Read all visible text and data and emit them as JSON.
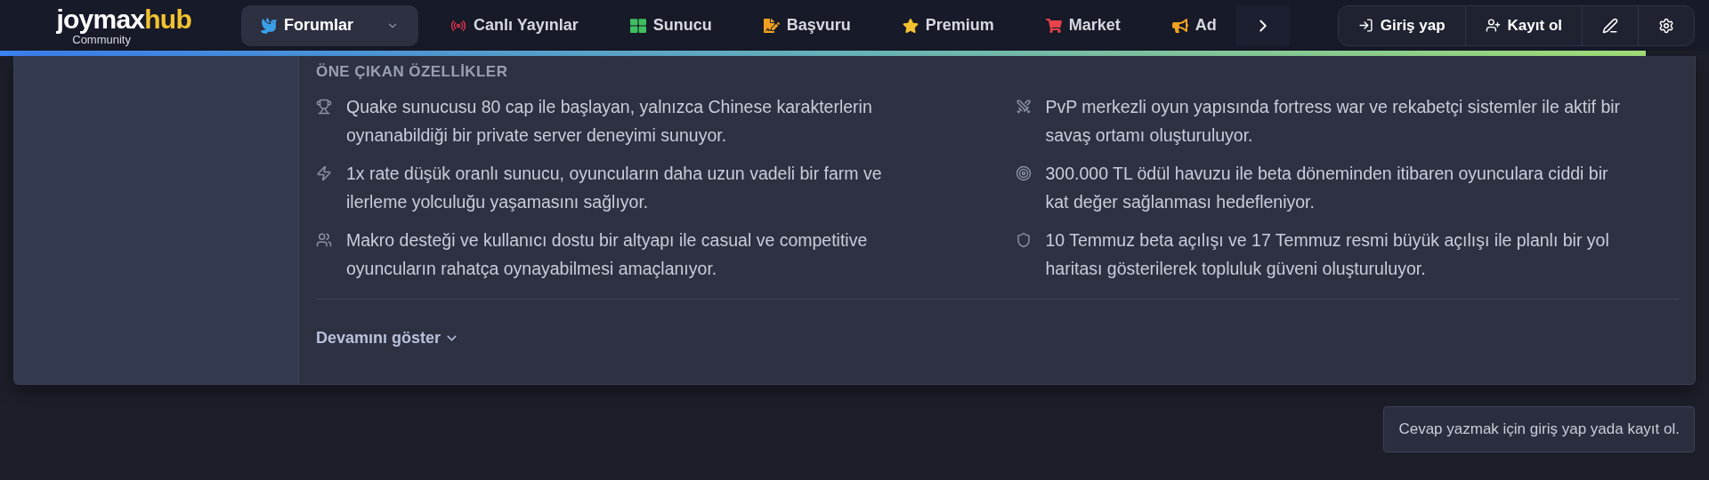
{
  "logo": {
    "main": "joymax",
    "accent": "hub",
    "sub": "Community"
  },
  "nav": [
    {
      "label": "Forumlar",
      "selected": true,
      "color": "#3b9fe8",
      "dropdown": true
    },
    {
      "label": "Canlı Yayınlar",
      "selected": false,
      "color": "#e0344d"
    },
    {
      "label": "Sunucu",
      "selected": false,
      "color": "#3fbf5f"
    },
    {
      "label": "Başvuru",
      "selected": false,
      "color": "#f0a020"
    },
    {
      "label": "Premium",
      "selected": false,
      "color": "#f2c230"
    },
    {
      "label": "Market",
      "selected": false,
      "color": "#e8424a"
    },
    {
      "label": "Ad",
      "selected": false,
      "color": "#f0a020"
    }
  ],
  "auth": [
    {
      "label": "Giriş yap"
    },
    {
      "label": "Kayıt ol"
    }
  ],
  "reading_progress": {
    "level": 0.963
  },
  "features": {
    "heading": "ÖNE ÇIKAN ÖZELLİKLER",
    "items": [
      {
        "text": "Quake sunucusu 80 cap ile başlayan, yalnızca Chinese karakterlerin oynanabildiği bir private server deneyimi sunuyor."
      },
      {
        "text": "PvP merkezli oyun yapısında fortress war ve rekabetçi sistemler ile aktif bir savaş ortamı oluşturuluyor."
      },
      {
        "text": "1x rate düşük oranlı sunucu, oyuncuların daha uzun vadeli bir farm ve ilerleme yolculuğu yaşamasını sağlıyor."
      },
      {
        "text": "300.000 TL ödül havuzu ile beta döneminden itibaren oyunculara ciddi bir kat değer sağlanması hedefleniyor."
      },
      {
        "text": "Makro desteği ve kullanıcı dostu bir altyapı ile casual ve competitive oyuncuların rahatça oynayabilmesi amaçlanıyor."
      },
      {
        "text": "10 Temmuz beta açılışı ve 17 Temmuz resmi büyük açılışı ile planlı bir yol haritası gösterilerek topluluk güveni oluşturuluyor."
      }
    ]
  },
  "show_more": "Devamını göster",
  "reply_notice": "Cevap yazmak için giriş yap yada kayıt ol."
}
